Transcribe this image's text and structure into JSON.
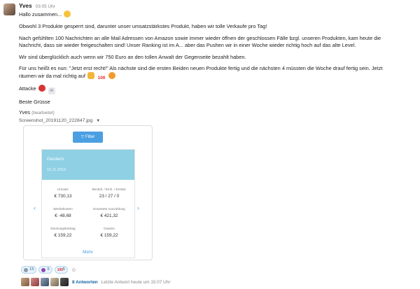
{
  "message": {
    "author": "Yves",
    "time": "03:05 Uhr",
    "greeting": "Hallo zusammen...",
    "paragraph1": "Obwohl 3 Produkte gesperrt sind, darunter unser umsatzstärkstes Produkt, haben wir tolle Verkaufe pro Tag!",
    "paragraph2_line1": "Nach gefühlten 100 Nachrichten an alle Mail Adressen von Amazon sowie immer wieder öffnen der geschlossen Fälle bzgl. unseren Produkten, kam heute die",
    "paragraph2_line2": "Nachricht, dass sie wieder freigeschalten sind! Unser Ranking ist im A... aber das Pushen wir in einer Woche wieder richtig hoch auf das alte Level.",
    "paragraph3": "Wir sind überglücklich auch wenn wir 750 Euro an den tollen Anwalt der Gegenseite bezahlt haben.",
    "paragraph4_line1": "Für uns heißt es nun: \"Jetzt erst recht!\" Als nächste sind die ersten Beiden neuen Produkte fertig und die nächsten 4 müssten die Woche drauf fertig sein. Jetzt",
    "paragraph4_line2": "räumen wir da mal richtig auf",
    "attacke": "Attacke",
    "closing": "Beste Grüsse",
    "signature": "Yves",
    "edited_label": "(bearbeitet)",
    "emoji_hundred": "100"
  },
  "attachment": {
    "filename": "Screenshot_20191120_222847.jpg",
    "caret_icon": "caret-down-icon"
  },
  "screenshot": {
    "filter_label": "Filter",
    "card_title": "Gestern",
    "card_date": "19.11.2019",
    "stats": [
      {
        "label": "Umsatz",
        "value": "€ 730,13"
      },
      {
        "label": "Bestell. / Einh. / Erstatt.",
        "value": "23 / 27 / 0"
      },
      {
        "label": "Werbekosten",
        "value": "€ -48,68"
      },
      {
        "label": "Erwartete Auszahlung",
        "value": "€ 421,32"
      },
      {
        "label": "Deckungsbeitrag",
        "value": "€ 159,22"
      },
      {
        "label": "Gewinn",
        "value": "€ 159,22"
      }
    ],
    "more_label": "Mehr",
    "accent_color": "#4a9fe3",
    "header_color": "#8fd0e4"
  },
  "reactions": [
    {
      "icon": "rocket-icon",
      "count": "15"
    },
    {
      "icon": "devil-icon",
      "count": "5"
    },
    {
      "icon": "hundred-icon",
      "count": "5",
      "glyph": "100"
    }
  ],
  "thread": {
    "replies": "8 Antworten",
    "last_reply": "Letzte Antwort heute um 15:07 Uhr"
  }
}
